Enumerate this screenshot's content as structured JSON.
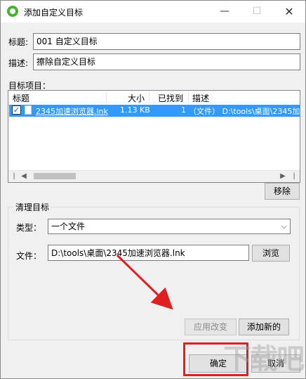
{
  "window": {
    "title": "添加自定义目标",
    "controls": {
      "minimize": "—",
      "maximize": "☐",
      "close": "✕"
    }
  },
  "form": {
    "title_label": "标题:",
    "title_value": "001 自定义目标",
    "desc_label": "描述:",
    "desc_value": "擦除自定义目标"
  },
  "items": {
    "section_label": "目标项目：",
    "columns": [
      "标题",
      "大小",
      "已找到",
      "描述"
    ],
    "rows": [
      {
        "title": "2345加速浏览器.lnk",
        "size": "1.13 KB",
        "found": "1",
        "desc": "（文件） D:\\tools\\桌面\\2345加"
      }
    ],
    "remove_label": "移除"
  },
  "cleanup": {
    "group_label": "清理目标",
    "type_label": "类型：",
    "type_value": "一个文件",
    "file_label": "文件：",
    "file_value": "D:\\tools\\桌面\\2345加速浏览器.lnk",
    "browse_label": "浏览",
    "apply_label": "应用改变",
    "add_new_label": "添加新的"
  },
  "footer": {
    "ok_label": "确定",
    "cancel_label": "取消"
  },
  "annotation": {
    "accent_color": "#e02020",
    "watermark": "下载吧"
  }
}
